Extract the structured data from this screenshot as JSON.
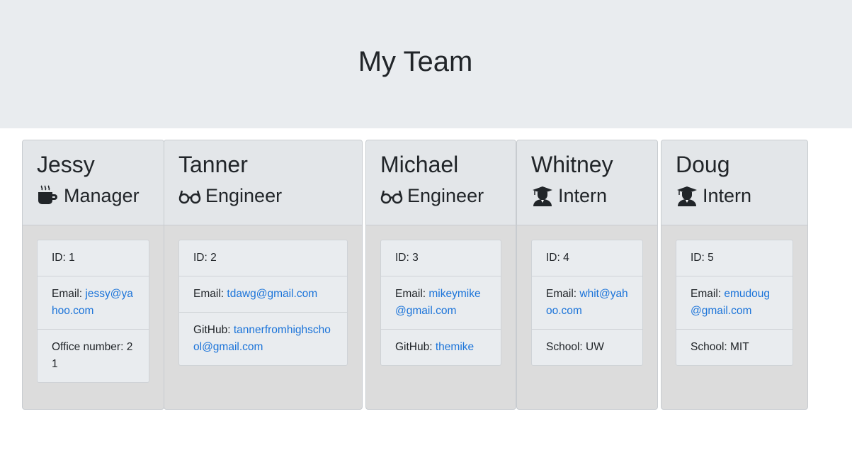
{
  "page": {
    "title": "My Team"
  },
  "team": [
    {
      "name": "Jessy",
      "role": "Manager",
      "role_icon": "mug-icon",
      "id_label": "ID:",
      "id": "1",
      "email_label": "Email:",
      "email": "jessy@yahoo.com",
      "extra_label": "Office number:",
      "extra": "21"
    },
    {
      "name": "Tanner",
      "role": "Engineer",
      "role_icon": "glasses-icon",
      "id_label": "ID:",
      "id": "2",
      "email_label": "Email:",
      "email": "tdawg@gmail.com",
      "extra_label": "GitHub:",
      "extra": "tannerfromhighschool@gmail.com"
    },
    {
      "name": "Michael",
      "role": "Engineer",
      "role_icon": "glasses-icon",
      "id_label": "ID:",
      "id": "3",
      "email_label": "Email:",
      "email": "mikeymike@gmail.com",
      "extra_label": "GitHub:",
      "extra": "themike"
    },
    {
      "name": "Whitney",
      "role": "Intern",
      "role_icon": "graduate-icon",
      "id_label": "ID:",
      "id": "4",
      "email_label": "Email:",
      "email": "whit@yahoo.com",
      "extra_label": "School:",
      "extra": "UW"
    },
    {
      "name": "Doug",
      "role": "Intern",
      "role_icon": "graduate-icon",
      "id_label": "ID:",
      "id": "5",
      "email_label": "Email:",
      "email": "emudoug@gmail.com",
      "extra_label": "School:",
      "extra": "MIT"
    }
  ],
  "colors": {
    "link": "#1a73d9",
    "card_bg": "#dcdcdc",
    "header_bg": "#e9ecef"
  }
}
